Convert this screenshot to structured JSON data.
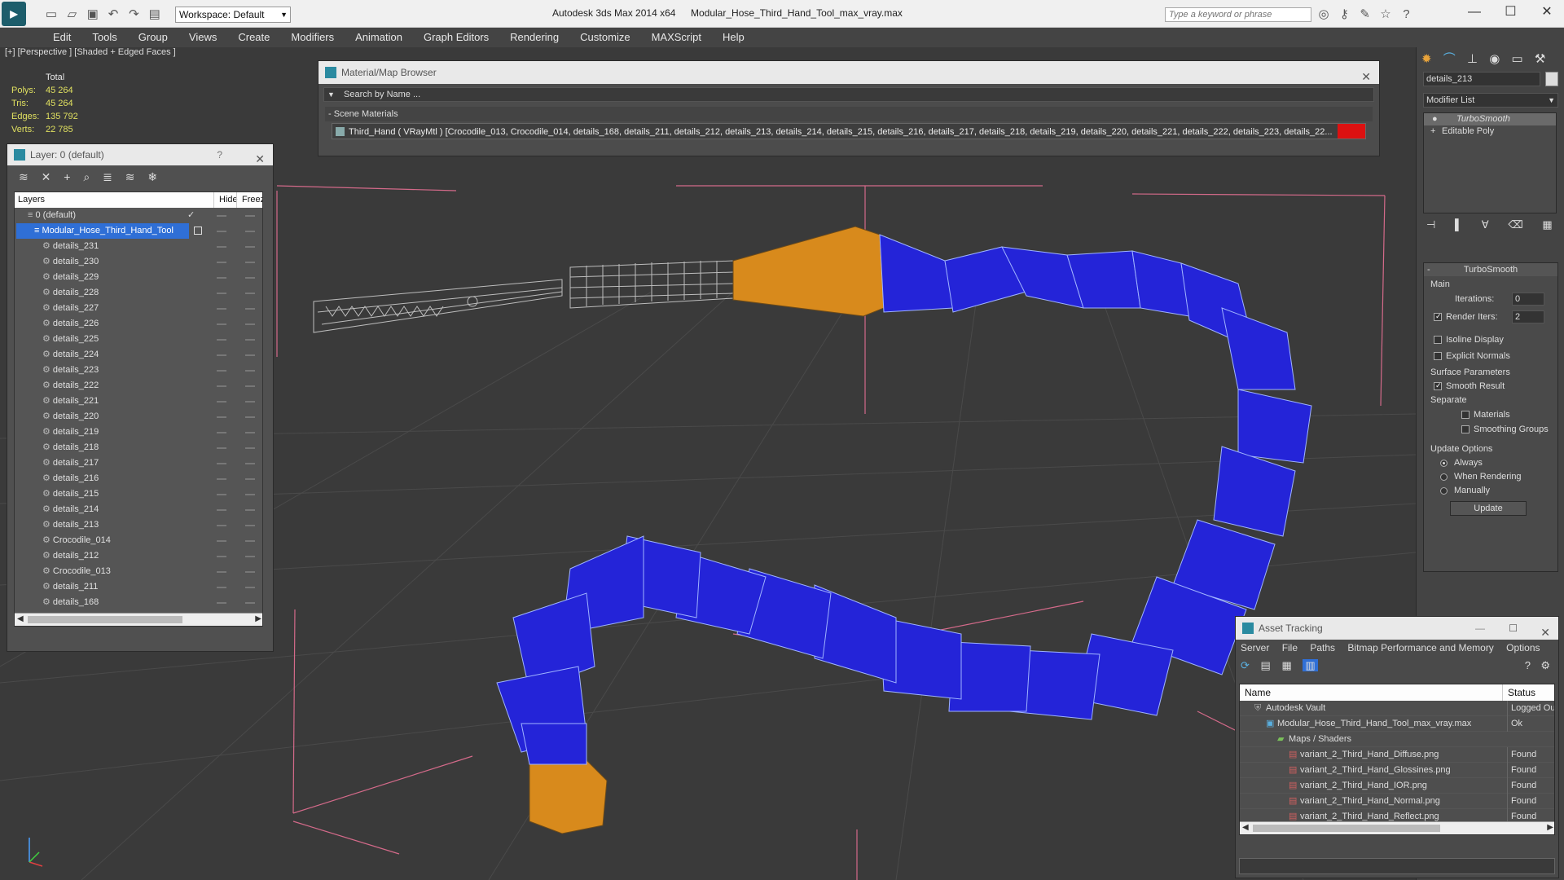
{
  "titlebar": {
    "workspace": "Workspace: Default",
    "app_title": "Autodesk 3ds Max  2014 x64",
    "file_title": "Modular_Hose_Third_Hand_Tool_max_vray.max",
    "search_placeholder": "Type a keyword or phrase"
  },
  "menu": [
    "Edit",
    "Tools",
    "Group",
    "Views",
    "Create",
    "Modifiers",
    "Animation",
    "Graph Editors",
    "Rendering",
    "Customize",
    "MAXScript",
    "Help"
  ],
  "viewport": {
    "label": "[+] [Perspective ] [Shaded + Edged Faces ]",
    "stats": {
      "header": "Total",
      "rows": [
        {
          "k": "Polys:",
          "v": "45 264"
        },
        {
          "k": "Tris:",
          "v": "45 264"
        },
        {
          "k": "Edges:",
          "v": "135 792"
        },
        {
          "k": "Verts:",
          "v": "22 785"
        }
      ]
    }
  },
  "layer_panel": {
    "title": "Layer: 0 (default)",
    "help": "?",
    "col_layers": "Layers",
    "col_hide": "Hide",
    "col_freeze": "Freeze",
    "root": "0 (default)",
    "selected": "Modular_Hose_Third_Hand_Tool",
    "items": [
      "details_231",
      "details_230",
      "details_229",
      "details_228",
      "details_227",
      "details_226",
      "details_225",
      "details_224",
      "details_223",
      "details_222",
      "details_221",
      "details_220",
      "details_219",
      "details_218",
      "details_217",
      "details_216",
      "details_215",
      "details_214",
      "details_213",
      "Crocodile_014",
      "details_212",
      "Crocodile_013",
      "details_211",
      "details_168",
      "Modular_Hose_Third_Hand_Tool"
    ]
  },
  "material_browser": {
    "title": "Material/Map Browser",
    "search": "Search by Name ...",
    "section": "- Scene Materials",
    "entry": "Third_Hand ( VRayMtl ) [Crocodile_013, Crocodile_014, details_168, details_211, details_212, details_213, details_214, details_215, details_216, details_217, details_218, details_219, details_220, details_221, details_222, details_223, details_22..."
  },
  "command_panel": {
    "object_name": "details_213",
    "modifier_list": "Modifier List",
    "stack": [
      "TurboSmooth",
      "Editable Poly"
    ],
    "rollout": "TurboSmooth",
    "main": "Main",
    "iterations_label": "Iterations:",
    "iterations": "0",
    "render_iters_label": "Render Iters:",
    "render_iters": "2",
    "isoline": "Isoline Display",
    "explicit": "Explicit Normals",
    "surface": "Surface Parameters",
    "smooth_result": "Smooth Result",
    "separate": "Separate",
    "materials": "Materials",
    "smoothing_groups": "Smoothing Groups",
    "update_options": "Update Options",
    "always": "Always",
    "when_rendering": "When Rendering",
    "manually": "Manually",
    "update_btn": "Update"
  },
  "asset_tracking": {
    "title": "Asset Tracking",
    "menu": [
      "Server",
      "File",
      "Paths",
      "Bitmap Performance and Memory",
      "Options"
    ],
    "col_name": "Name",
    "col_status": "Status",
    "rows": [
      {
        "name": "Autodesk Vault",
        "status": "Logged Ou",
        "indent": 0
      },
      {
        "name": "Modular_Hose_Third_Hand_Tool_max_vray.max",
        "status": "Ok",
        "indent": 1
      },
      {
        "name": "Maps / Shaders",
        "status": "",
        "indent": 2
      },
      {
        "name": "variant_2_Third_Hand_Diffuse.png",
        "status": "Found",
        "indent": 3
      },
      {
        "name": "variant_2_Third_Hand_Glossines.png",
        "status": "Found",
        "indent": 3
      },
      {
        "name": "variant_2_Third_Hand_IOR.png",
        "status": "Found",
        "indent": 3
      },
      {
        "name": "variant_2_Third_Hand_Normal.png",
        "status": "Found",
        "indent": 3
      },
      {
        "name": "variant_2_Third_Hand_Reflect.png",
        "status": "Found",
        "indent": 3
      }
    ]
  },
  "colors": {
    "selection": "#2f6fd6",
    "hose_blue": "#2424d8",
    "hose_orange": "#d88a1c",
    "guide_pink": "#d46a8a"
  }
}
